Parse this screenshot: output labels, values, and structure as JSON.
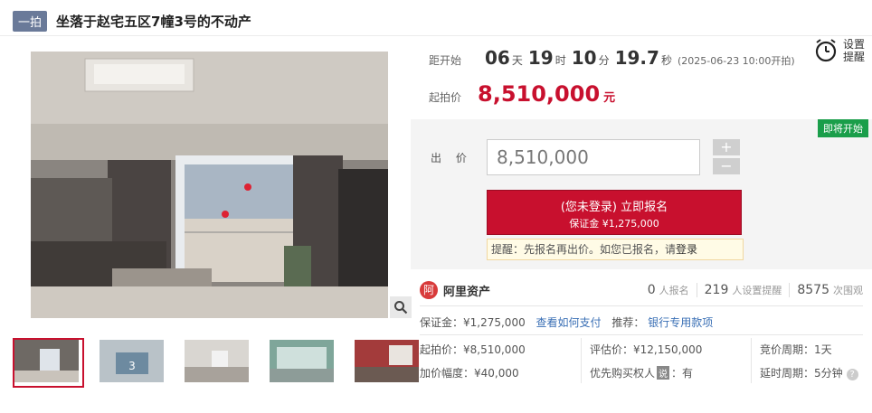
{
  "header": {
    "badge": "一拍",
    "title": "坐落于赵宅五区7幢3号的不动产"
  },
  "countdown": {
    "label": "距开始",
    "days": "06",
    "days_unit": "天",
    "hours": "19",
    "hours_unit": "时",
    "minutes": "10",
    "minutes_unit": "分",
    "seconds": "19.7",
    "seconds_unit": "秒",
    "start_note": "(2025-06-23 10:00开拍)"
  },
  "reminder": {
    "line1": "设置",
    "line2": "提醒"
  },
  "start_price": {
    "label": "起拍价",
    "value": "8,510,000",
    "unit": "元"
  },
  "bid": {
    "status_tag": "即将开始",
    "label": "出 价",
    "input_value": "8,510,000",
    "plus": "+",
    "minus": "−",
    "signup_line1": "(您未登录) 立即报名",
    "signup_line2": "保证金 ¥1,275,000",
    "tip_prefix": "提醒：先报名再出价。如您已报名，请",
    "tip_link": "登录"
  },
  "platform": {
    "logo_char": "阿",
    "name": "阿里资产"
  },
  "stats": [
    {
      "num": "0",
      "label": "人报名"
    },
    {
      "num": "219",
      "label": "人设置提醒"
    },
    {
      "num": "8575",
      "label": "次围观"
    }
  ],
  "deposit": {
    "text": "保证金：¥1,275,000",
    "link1": "查看如何支付",
    "recommend": "推荐：",
    "link2": "银行专用款项"
  },
  "details": {
    "start_price": "起拍价：¥8,510,000",
    "increment": "加价幅度：¥40,000",
    "appraisal": "评估价：¥12,150,000",
    "priority_label": "优先购买权人",
    "priority_badge": "说",
    "priority_value": "：有",
    "cycle": "竞价周期：1天",
    "delay": "延时周期：5分钟",
    "help": "?"
  }
}
